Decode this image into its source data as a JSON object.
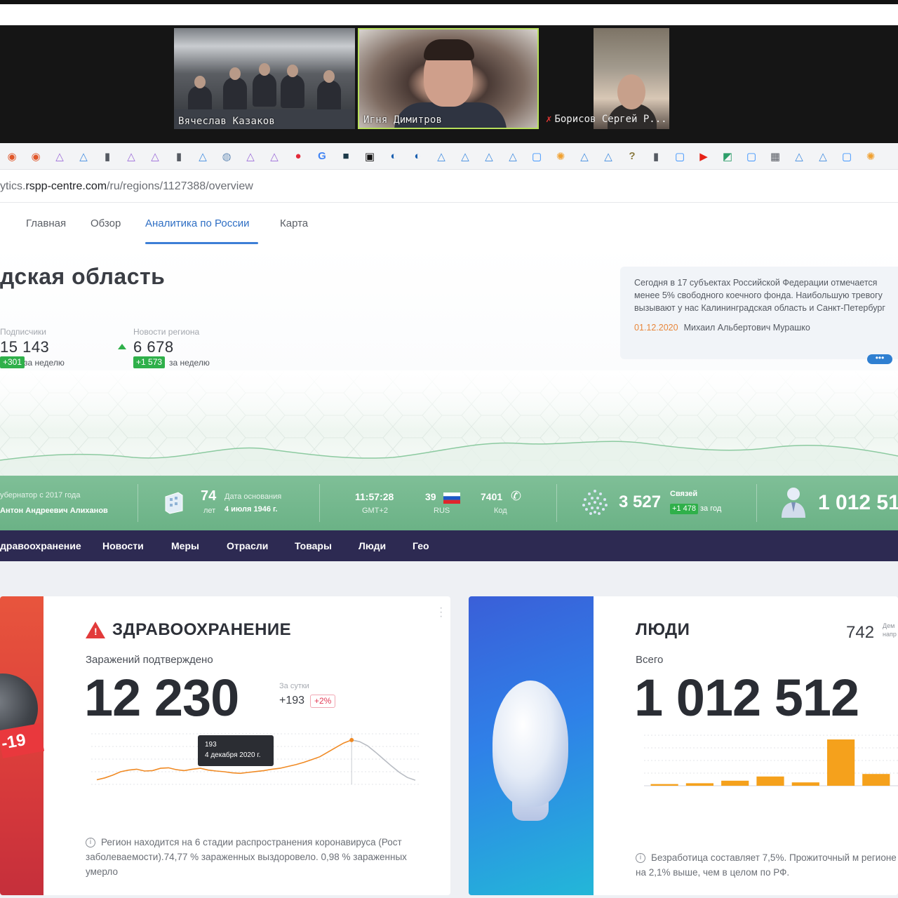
{
  "video_call": {
    "participants": [
      {
        "name": "Вячеслав Казаков"
      },
      {
        "name": "Игня Димитров"
      },
      {
        "name": "Борисов Сергей Р..."
      }
    ]
  },
  "bookmarks": [
    {
      "icon": "orange-swirl-icon",
      "glyph": "◉",
      "color": "#e0572a"
    },
    {
      "icon": "orange-swirl-icon",
      "glyph": "◉",
      "color": "#e0572a"
    },
    {
      "icon": "triangle-logo-icon",
      "glyph": "△",
      "color": "#9c6bd8"
    },
    {
      "icon": "triangle-logo-icon",
      "glyph": "△",
      "color": "#3f8be0"
    },
    {
      "icon": "document-icon",
      "glyph": "▮",
      "color": "#555a62"
    },
    {
      "icon": "triangle-logo-icon",
      "glyph": "△",
      "color": "#9c6bd8"
    },
    {
      "icon": "triangle-logo-icon",
      "glyph": "△",
      "color": "#9c6bd8"
    },
    {
      "icon": "document-icon",
      "glyph": "▮",
      "color": "#555a62"
    },
    {
      "icon": "triangle-logo-icon",
      "glyph": "△",
      "color": "#3f8be0"
    },
    {
      "icon": "globe-icon",
      "glyph": "◍",
      "color": "#6a8fb8"
    },
    {
      "icon": "triangle-logo-icon",
      "glyph": "△",
      "color": "#9c6bd8"
    },
    {
      "icon": "triangle-logo-icon",
      "glyph": "△",
      "color": "#9c6bd8"
    },
    {
      "icon": "pinterest-icon",
      "glyph": "●",
      "color": "#e32a3a"
    },
    {
      "icon": "google-icon",
      "glyph": "G",
      "color": "#4285f4"
    },
    {
      "icon": "dark-app-icon",
      "glyph": "■",
      "color": "#1d3a4a"
    },
    {
      "icon": "film-icon",
      "glyph": "▣",
      "color": "#111111"
    },
    {
      "icon": "circle-blue-icon",
      "glyph": "◐",
      "color": "#1a5fb0"
    },
    {
      "icon": "circle-blue-icon",
      "glyph": "◐",
      "color": "#1a5fb0"
    },
    {
      "icon": "triangle-logo-icon",
      "glyph": "△",
      "color": "#3f8be0"
    },
    {
      "icon": "triangle-logo-icon",
      "glyph": "△",
      "color": "#3f8be0"
    },
    {
      "icon": "triangle-logo-icon",
      "glyph": "△",
      "color": "#3f8be0"
    },
    {
      "icon": "triangle-logo-icon",
      "glyph": "△",
      "color": "#3f8be0"
    },
    {
      "icon": "zoom-icon",
      "glyph": "▢",
      "color": "#2d8cff"
    },
    {
      "icon": "sun-icon",
      "glyph": "✺",
      "color": "#f0a030"
    },
    {
      "icon": "triangle-logo-icon",
      "glyph": "△",
      "color": "#3f8be0"
    },
    {
      "icon": "triangle-logo-icon",
      "glyph": "△",
      "color": "#3f8be0"
    },
    {
      "icon": "help-icon",
      "glyph": "?",
      "color": "#8a7a40"
    },
    {
      "icon": "document-icon",
      "glyph": "▮",
      "color": "#555a62"
    },
    {
      "icon": "zoom-icon",
      "glyph": "▢",
      "color": "#2d8cff"
    },
    {
      "icon": "youtube-icon",
      "glyph": "▶",
      "color": "#e62117"
    },
    {
      "icon": "sheet-icon",
      "glyph": "◩",
      "color": "#2e9e6a"
    },
    {
      "icon": "zoom-icon",
      "glyph": "▢",
      "color": "#2d8cff"
    },
    {
      "icon": "grid-apps-icon",
      "glyph": "▦",
      "color": "#5a5e66"
    },
    {
      "icon": "triangle-logo-icon",
      "glyph": "△",
      "color": "#3f8be0"
    },
    {
      "icon": "triangle-logo-icon",
      "glyph": "△",
      "color": "#3f8be0"
    },
    {
      "icon": "zoom-icon",
      "glyph": "▢",
      "color": "#2d8cff"
    },
    {
      "icon": "sun-icon",
      "glyph": "✺",
      "color": "#f0a030"
    }
  ],
  "address": {
    "url_prefix": "ytics.",
    "url_domain": "rspp-centre.com",
    "url_path": "/ru/regions/1127388/overview"
  },
  "nav": {
    "tabs": [
      "Главная",
      "Обзор",
      "Аналитика по России",
      "Карта"
    ],
    "active_index": 2
  },
  "hero": {
    "region_title": "дская область",
    "subscribers": {
      "label": "Подписчики",
      "value": "15 143",
      "delta": "+301",
      "period": "за неделю"
    },
    "news": {
      "label": "Новости региона",
      "value": "6 678",
      "delta": "+1 573",
      "period": "за неделю"
    },
    "quote": {
      "text": "Сегодня в 17 субъектах Российской Федерации отмечается менее 5% свободного коечного фонда. Наибольшую тревогу вызывают у нас Калининградская область и Санкт-Петербург",
      "date": "01.12.2020",
      "author": "Михаил Альбертович Мурашко",
      "more": "•••"
    }
  },
  "strip": {
    "governor_label": "убернатор с 2017 года",
    "governor_name": "Антон Андреевич Алиханов",
    "age_value": "74",
    "age_unit": "лет",
    "founded_label": "Дата основания",
    "founded_date": "4 июля 1946 г.",
    "time_value": "11:57:28",
    "time_zone": "GMT+2",
    "region_code": "39",
    "country": "RUS",
    "phone_code": "7401",
    "phone_label": "Код",
    "links_value": "3 527",
    "links_label": "Связей",
    "links_delta": "+1 478",
    "links_period": "за год",
    "population_value": "1 012 51"
  },
  "sections": [
    "дравоохранение",
    "Новости",
    "Меры",
    "Отрасли",
    "Товары",
    "Люди",
    "Гео"
  ],
  "health_card": {
    "virus_label": "-19",
    "title": "ЗДРАВООХРАНЕНИЕ",
    "subtitle": "Заражений подтверждено",
    "value": "12 230",
    "perday_label": "За сутки",
    "perday_value": "+193",
    "perday_pct": "+2%",
    "tooltip_value": "193",
    "tooltip_date": "4 декабря 2020 г.",
    "note": "Регион находится на 6 стадии распространения коронавируса (Рост заболеваемости).74,77 % зараженных выздоровело. 0,98 % зараженных умерло"
  },
  "people_card": {
    "title": "ЛЮДИ",
    "count": "742",
    "tiny_label": "Дем\nнапр",
    "subtitle": "Всего",
    "value": "1 012 512",
    "note": "Безработица составляет 7,5%. Прожиточный м регионе на 2,1% выше, чем в целом по РФ."
  },
  "colors": {
    "accent": "#3d7fd6",
    "positive": "#2fb04a",
    "strip": "#6bb286",
    "secnav": "#2d2a52",
    "danger": "#e23a3a",
    "bar": "#f5a11c"
  },
  "chart_data": [
    {
      "type": "line",
      "x": [
        0,
        1,
        2,
        3,
        4,
        5,
        6,
        7,
        8,
        9,
        10,
        11,
        12,
        13,
        14,
        15,
        16,
        17,
        18,
        19,
        20,
        21,
        22,
        23,
        24,
        25,
        26,
        27,
        28,
        29,
        30,
        31,
        32,
        33,
        34,
        35,
        36,
        37,
        38,
        39,
        40
      ],
      "series": [
        {
          "values": [
            20,
            28,
            40,
            55,
            62,
            66,
            58,
            60,
            70,
            72,
            64,
            60,
            66,
            70,
            62,
            58,
            55,
            50,
            48,
            52,
            56,
            60,
            66,
            70,
            78,
            86,
            96,
            108,
            120,
            140,
            160,
            180,
            193,
            186,
            168,
            140,
            110,
            80,
            52,
            30,
            18
          ]
        }
      ],
      "ylim": [
        0,
        220
      ]
    },
    {
      "type": "bar",
      "values": [
        4,
        6,
        12,
        22,
        8,
        110,
        28
      ],
      "ylim": [
        0,
        120
      ]
    }
  ]
}
